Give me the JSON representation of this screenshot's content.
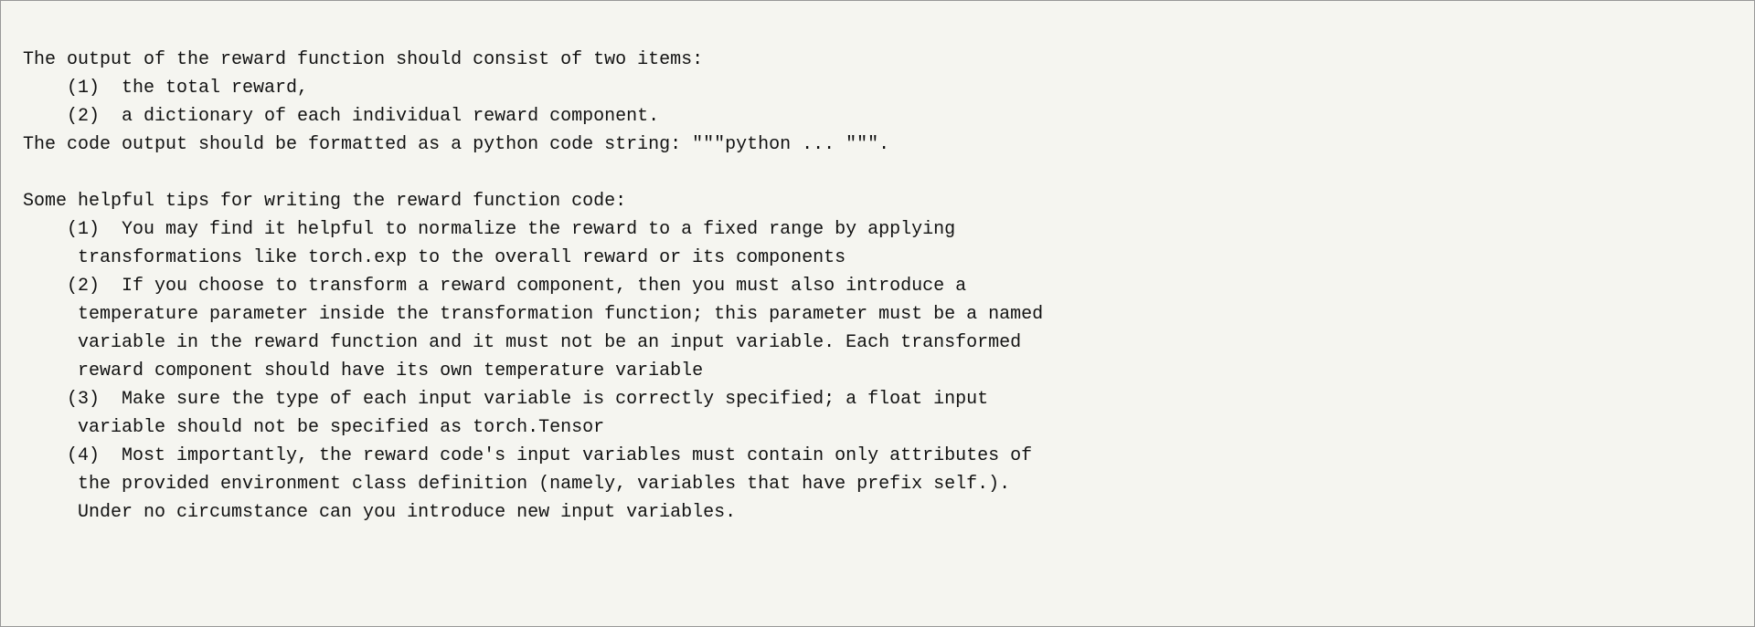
{
  "content": {
    "lines": [
      "The output of the reward function should consist of two items:",
      "    (1)  the total reward,",
      "    (2)  a dictionary of each individual reward component.",
      "The code output should be formatted as a python code string: \"\"\"python ... \"\"\".",
      "",
      "Some helpful tips for writing the reward function code:",
      "    (1)  You may find it helpful to normalize the reward to a fixed range by applying",
      "     transformations like torch.exp to the overall reward or its components",
      "    (2)  If you choose to transform a reward component, then you must also introduce a",
      "     temperature parameter inside the transformation function; this parameter must be a named",
      "     variable in the reward function and it must not be an input variable. Each transformed",
      "     reward component should have its own temperature variable",
      "    (3)  Make sure the type of each input variable is correctly specified; a float input",
      "     variable should not be specified as torch.Tensor",
      "    (4)  Most importantly, the reward code's input variables must contain only attributes of",
      "     the provided environment class definition (namely, variables that have prefix self.).",
      "     Under no circumstance can you introduce new input variables."
    ]
  }
}
